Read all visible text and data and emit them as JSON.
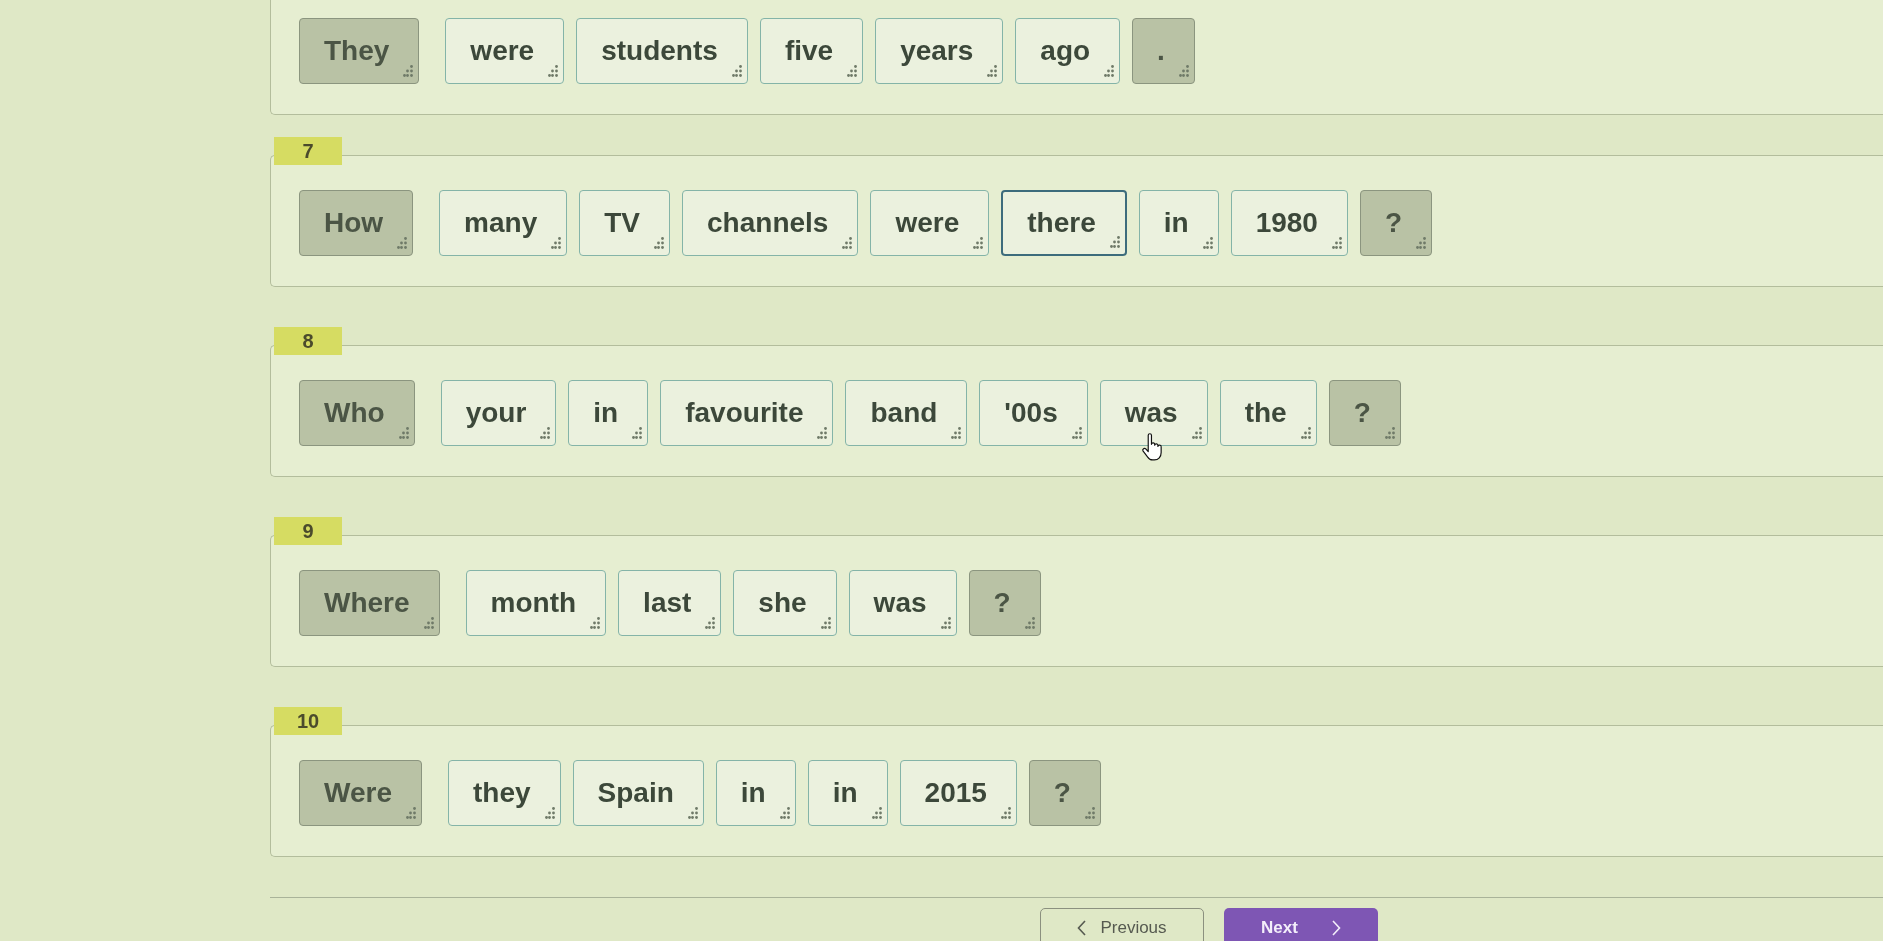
{
  "questions": [
    {
      "tiles": [
        {
          "text": "They",
          "kind": "fixed",
          "selected": false,
          "hovered": false
        },
        {
          "text": "were",
          "kind": "word",
          "selected": false,
          "hovered": false
        },
        {
          "text": "students",
          "kind": "word",
          "selected": false,
          "hovered": false
        },
        {
          "text": "five",
          "kind": "word",
          "selected": false,
          "hovered": false
        },
        {
          "text": "years",
          "kind": "word",
          "selected": false,
          "hovered": false
        },
        {
          "text": "ago",
          "kind": "word",
          "selected": false,
          "hovered": false
        },
        {
          "text": ".",
          "kind": "fixed",
          "selected": false,
          "hovered": false
        }
      ]
    },
    {
      "number": "7",
      "tiles": [
        {
          "text": "How",
          "kind": "fixed",
          "selected": false,
          "hovered": false
        },
        {
          "text": "many",
          "kind": "word",
          "selected": false,
          "hovered": false
        },
        {
          "text": "TV",
          "kind": "word",
          "selected": false,
          "hovered": false
        },
        {
          "text": "channels",
          "kind": "word",
          "selected": false,
          "hovered": false
        },
        {
          "text": "were",
          "kind": "word",
          "selected": false,
          "hovered": false
        },
        {
          "text": "there",
          "kind": "word",
          "selected": true,
          "hovered": false
        },
        {
          "text": "in",
          "kind": "word",
          "selected": false,
          "hovered": false
        },
        {
          "text": "1980",
          "kind": "word",
          "selected": false,
          "hovered": false
        },
        {
          "text": "?",
          "kind": "fixed",
          "selected": false,
          "hovered": false
        }
      ]
    },
    {
      "number": "8",
      "tiles": [
        {
          "text": "Who",
          "kind": "fixed",
          "selected": false,
          "hovered": false
        },
        {
          "text": "your",
          "kind": "word",
          "selected": false,
          "hovered": false
        },
        {
          "text": "in",
          "kind": "word",
          "selected": false,
          "hovered": false
        },
        {
          "text": "favourite",
          "kind": "word",
          "selected": false,
          "hovered": false
        },
        {
          "text": "band",
          "kind": "word",
          "selected": false,
          "hovered": false
        },
        {
          "text": "'00s",
          "kind": "word",
          "selected": false,
          "hovered": false
        },
        {
          "text": "was",
          "kind": "word",
          "selected": false,
          "hovered": true
        },
        {
          "text": "the",
          "kind": "word",
          "selected": false,
          "hovered": false
        },
        {
          "text": "?",
          "kind": "fixed",
          "selected": false,
          "hovered": false
        }
      ]
    },
    {
      "number": "9",
      "tiles": [
        {
          "text": "Where",
          "kind": "fixed",
          "selected": false,
          "hovered": false
        },
        {
          "text": "month",
          "kind": "word",
          "selected": false,
          "hovered": false
        },
        {
          "text": "last",
          "kind": "word",
          "selected": false,
          "hovered": false
        },
        {
          "text": "she",
          "kind": "word",
          "selected": false,
          "hovered": false
        },
        {
          "text": "was",
          "kind": "word",
          "selected": false,
          "hovered": false
        },
        {
          "text": "?",
          "kind": "fixed",
          "selected": false,
          "hovered": false
        }
      ]
    },
    {
      "number": "10",
      "tiles": [
        {
          "text": "Were",
          "kind": "fixed",
          "selected": false,
          "hovered": false
        },
        {
          "text": "they",
          "kind": "word",
          "selected": false,
          "hovered": false
        },
        {
          "text": "Spain",
          "kind": "word",
          "selected": false,
          "hovered": false
        },
        {
          "text": "in",
          "kind": "word",
          "selected": false,
          "hovered": false
        },
        {
          "text": "in",
          "kind": "word",
          "selected": false,
          "hovered": false
        },
        {
          "text": "2015",
          "kind": "word",
          "selected": false,
          "hovered": false
        },
        {
          "text": "?",
          "kind": "fixed",
          "selected": false,
          "hovered": false
        }
      ]
    }
  ],
  "navigation": {
    "previous": "Previous",
    "next": "Next"
  }
}
